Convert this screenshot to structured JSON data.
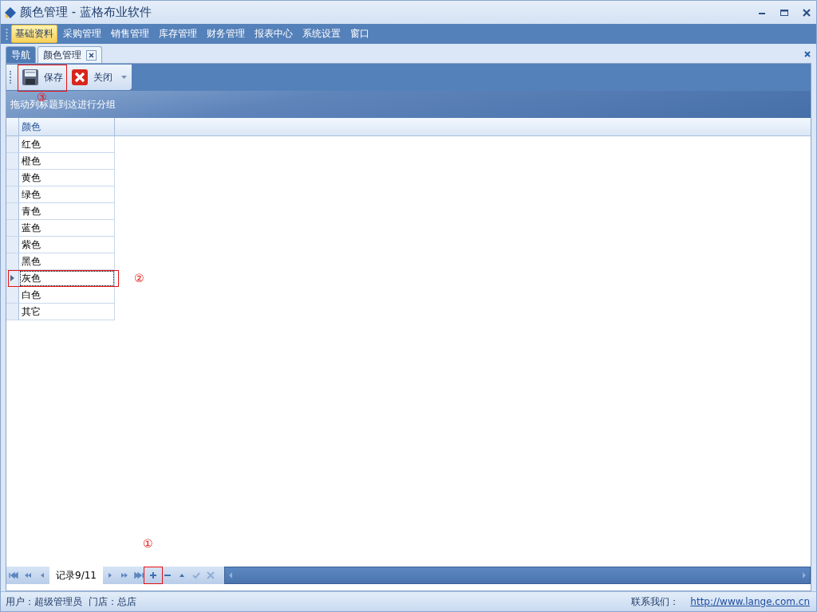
{
  "window": {
    "title": "颜色管理 - 蓝格布业软件"
  },
  "menu": [
    {
      "label": "基础资料",
      "selected": true
    },
    {
      "label": "采购管理",
      "selected": false
    },
    {
      "label": "销售管理",
      "selected": false
    },
    {
      "label": "库存管理",
      "selected": false
    },
    {
      "label": "财务管理",
      "selected": false
    },
    {
      "label": "报表中心",
      "selected": false
    },
    {
      "label": "系统设置",
      "selected": false
    },
    {
      "label": "窗口",
      "selected": false
    }
  ],
  "tabs": [
    {
      "label": "导航",
      "selected": false,
      "closable": false
    },
    {
      "label": "颜色管理",
      "selected": true,
      "closable": true
    }
  ],
  "toolbar": [
    {
      "kind": "save",
      "label": "保存",
      "annotation": "③"
    },
    {
      "kind": "close",
      "label": "关闭"
    }
  ],
  "group_panel": {
    "text": "拖动列标题到这进行分组"
  },
  "table": {
    "columns": [
      "颜色"
    ],
    "rows": [
      {
        "cells": [
          "红色"
        ],
        "selected": false
      },
      {
        "cells": [
          "橙色"
        ],
        "selected": false
      },
      {
        "cells": [
          "黄色"
        ],
        "selected": false
      },
      {
        "cells": [
          "绿色"
        ],
        "selected": false
      },
      {
        "cells": [
          "青色"
        ],
        "selected": false
      },
      {
        "cells": [
          "蓝色"
        ],
        "selected": false
      },
      {
        "cells": [
          "紫色"
        ],
        "selected": false
      },
      {
        "cells": [
          "黑色"
        ],
        "selected": false
      },
      {
        "cells": [
          "灰色"
        ],
        "selected": true,
        "annotation": "②"
      },
      {
        "cells": [
          "白色"
        ],
        "selected": false
      },
      {
        "cells": [
          "其它"
        ],
        "selected": false
      }
    ]
  },
  "navigator": {
    "record": "记录9/11",
    "before": [
      {
        "kind": "first"
      },
      {
        "kind": "prev-page"
      },
      {
        "kind": "prev"
      }
    ],
    "after": [
      {
        "kind": "next",
        "disabled": false
      },
      {
        "kind": "next-page",
        "disabled": false
      },
      {
        "kind": "last",
        "disabled": false
      },
      {
        "kind": "add",
        "disabled": false,
        "annotation": "①"
      },
      {
        "kind": "remove",
        "disabled": false
      },
      {
        "kind": "edit",
        "disabled": false
      },
      {
        "kind": "confirm",
        "disabled": true
      },
      {
        "kind": "cancel",
        "disabled": true
      }
    ]
  },
  "status_bar": {
    "user": "用户：超级管理员  门店：总店",
    "contact_label": "联系我们：",
    "contact_link": "http://www.lange.com.cn"
  }
}
